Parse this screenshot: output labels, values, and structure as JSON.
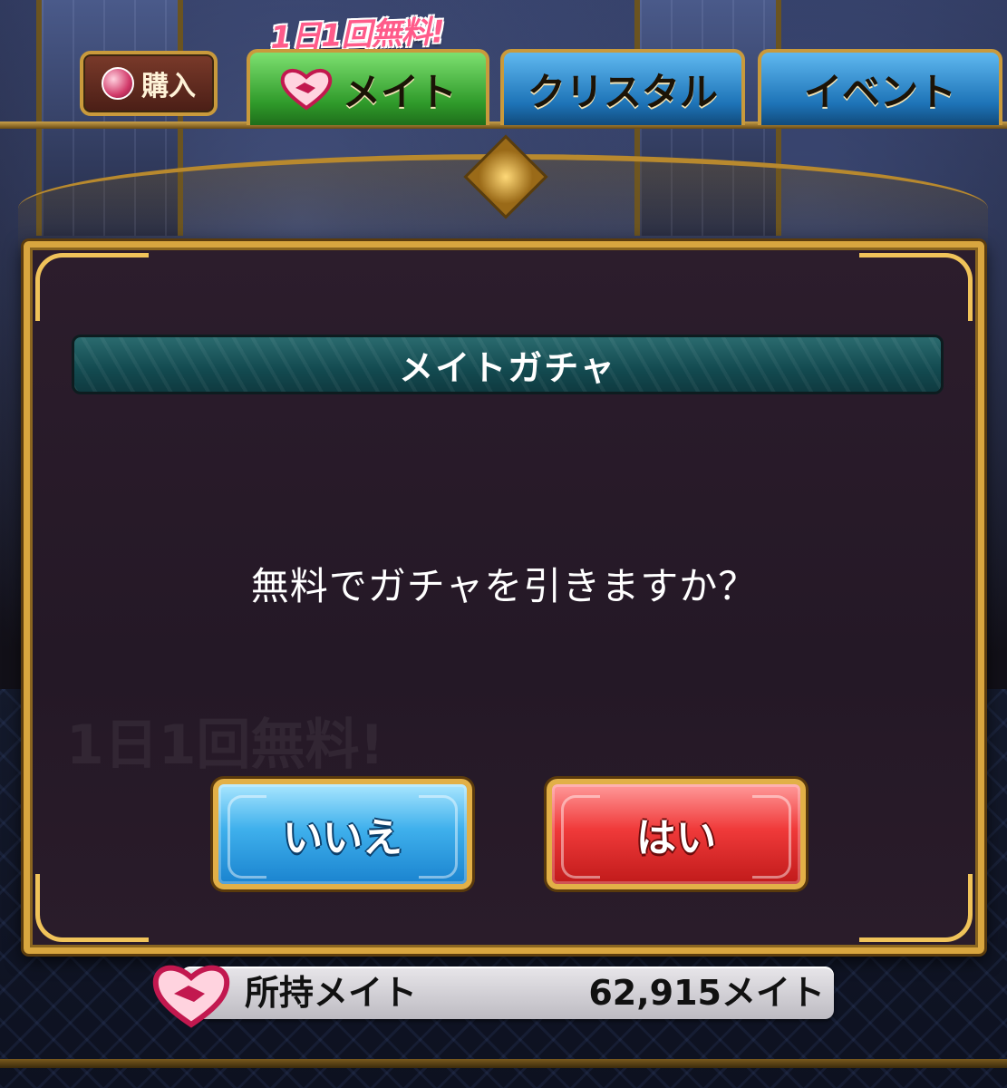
{
  "header": {
    "promo_banner": "1日1回無料!",
    "buy_label": "購入",
    "tabs": [
      {
        "label": "メイト",
        "active": true,
        "color": "#3fae36"
      },
      {
        "label": "クリスタル",
        "active": false,
        "color": "#1e74b8"
      },
      {
        "label": "イベント",
        "active": false,
        "color": "#1e74b8"
      }
    ]
  },
  "dialog": {
    "title": "メイトガチャ",
    "message": "無料でガチャを引きますか？",
    "no_label": "いいえ",
    "yes_label": "はい",
    "background_hint": "1日1回無料!"
  },
  "owned": {
    "label": "所持メイト",
    "value": "62,915メイト"
  },
  "colors": {
    "gold": "#d9a63f",
    "no_button": "#2a97dc",
    "yes_button": "#e22b2b",
    "dialog_bg": "#261a28",
    "title_bar": "#1a5a60"
  },
  "icons": [
    "gem-icon",
    "heart-handshake-icon"
  ]
}
